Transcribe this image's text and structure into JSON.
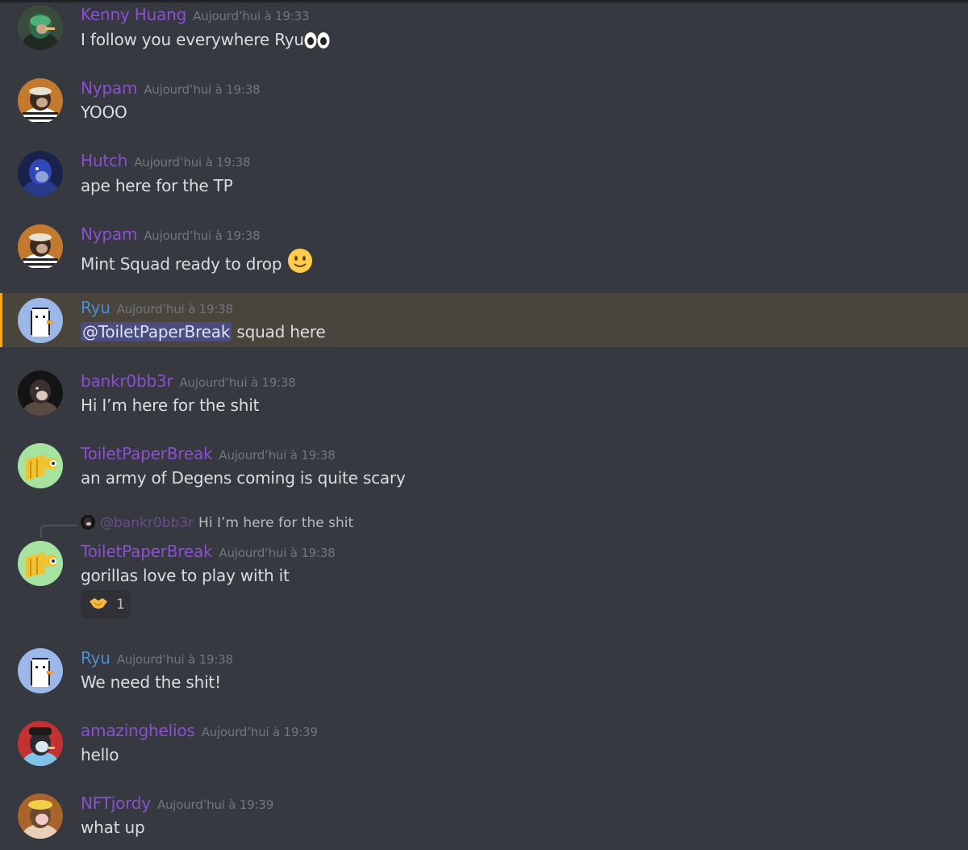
{
  "messages": [
    {
      "username": "Kenny Huang",
      "timestamp": "Aujourd’hui à 19:33",
      "content": "I follow you everywhere Ryu",
      "avatar": "green-gorilla-avatar"
    },
    {
      "username": "Nypam",
      "timestamp": "Aujourd’hui à 19:38",
      "content": "YOOO",
      "avatar": "striped-gorilla-avatar"
    },
    {
      "username": "Hutch",
      "timestamp": "Aujourd’hui à 19:38",
      "content": "ape here for the TP",
      "avatar": "blue-gorilla-avatar"
    },
    {
      "username": "Nypam",
      "timestamp": "Aujourd’hui à 19:38",
      "content": "Mint Squad ready to drop",
      "avatar": "striped-gorilla-avatar"
    },
    {
      "username": "Ryu",
      "timestamp": "Aujourd’hui à 19:38",
      "mention": "@ToiletPaperBreak",
      "content": " squad here",
      "avatar": "pixel-penguin-avatar"
    },
    {
      "username": "bankr0bb3r",
      "timestamp": "Aujourd’hui à 19:38",
      "content": "Hi I’m here for the shit",
      "avatar": "dark-gorilla-avatar"
    },
    {
      "username": "ToiletPaperBreak",
      "timestamp": "Aujourd’hui à 19:38",
      "content": "an army of Degens coming is quite scary",
      "avatar": "toilet-paper-avatar"
    },
    {
      "username": "ToiletPaperBreak",
      "timestamp": "Aujourd’hui à 19:38",
      "content": "gorillas love to play with it",
      "avatar": "toilet-paper-avatar",
      "reply_to": {
        "username": "@bankr0bb3r",
        "content": "Hi I’m here for the shit"
      },
      "reaction": {
        "emoji": "handshake-emoji",
        "count": "1"
      }
    },
    {
      "username": "Ryu",
      "timestamp": "Aujourd’hui à 19:38",
      "content": "We need the shit!",
      "avatar": "pixel-penguin-avatar"
    },
    {
      "username": "amazinghelios",
      "timestamp": "Aujourd’hui à 19:39",
      "content": "hello",
      "avatar": "red-hat-gorilla-avatar"
    },
    {
      "username": "NFTjordy",
      "timestamp": "Aujourd’hui à 19:39",
      "content": "what up",
      "avatar": "blonde-gorilla-avatar"
    }
  ],
  "colors": {
    "background": "#36393f",
    "username_purple": "#8b4fd1",
    "username_blue": "#4a8fd6",
    "mention_highlight": "#49443c",
    "mention_bar": "#faa81a",
    "text": "#dcddde",
    "timestamp": "#72767d"
  }
}
